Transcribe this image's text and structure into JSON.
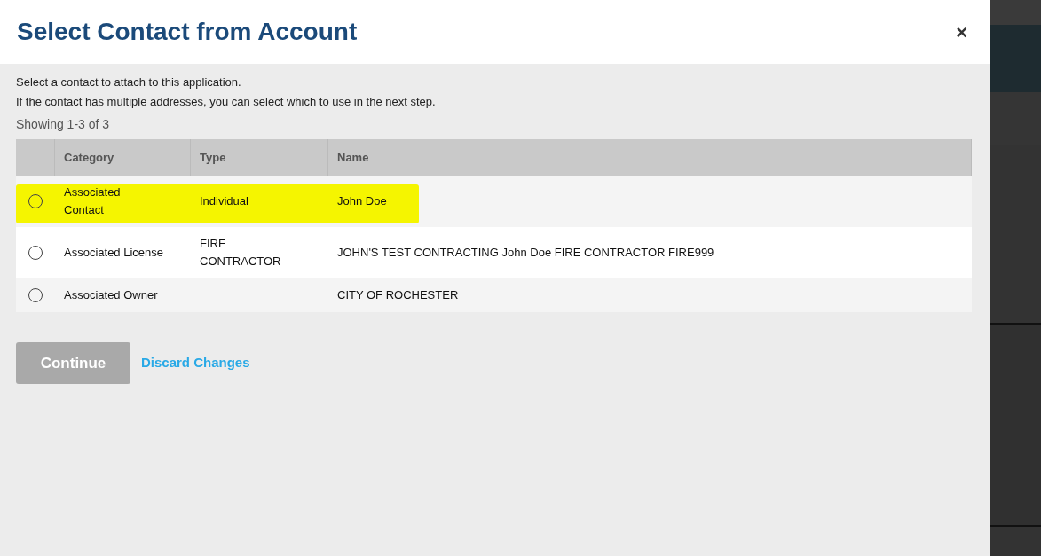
{
  "dialog": {
    "title": "Select Contact from Account",
    "close": "×"
  },
  "instructions": [
    "Select a contact to attach to this application.",
    "If the contact has multiple addresses, you can select which to use in the next step."
  ],
  "result_count": "Showing 1-3 of 3",
  "table": {
    "columns": [
      "Category",
      "Type",
      "Name"
    ],
    "rows": [
      {
        "selected": false,
        "highlighted": true,
        "category": "Associated Contact",
        "type": "Individual",
        "name": "John Doe"
      },
      {
        "selected": false,
        "highlighted": false,
        "category": "Associated License",
        "type": "FIRE CONTRACTOR",
        "name": "JOHN'S TEST CONTRACTING John Doe FIRE CONTRACTOR FIRE999"
      },
      {
        "selected": false,
        "highlighted": false,
        "category": "Associated Owner",
        "type": "",
        "name": "CITY OF ROCHESTER"
      }
    ]
  },
  "buttons": [
    {
      "kind": "primary",
      "label": "Continue",
      "disabled": true
    },
    {
      "kind": "link",
      "label": "Discard Changes",
      "disabled": false
    }
  ]
}
